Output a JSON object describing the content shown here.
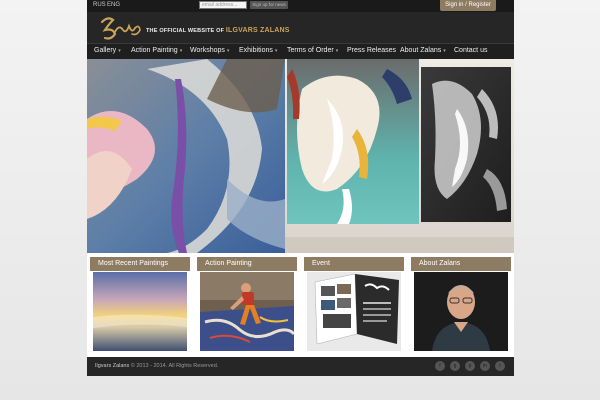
{
  "topbar": {
    "lang_rus": "RUS",
    "lang_eng": "ENG",
    "email_placeholder": "email address...",
    "signup_label": "Sign up for news",
    "signin_label": "Sign in / Register"
  },
  "header": {
    "tagline_prefix": "THE OFFICIAL WEBSITE OF",
    "tagline_name": "ILGVARS ZALANS"
  },
  "nav": {
    "items": [
      {
        "label": "Gallery",
        "has_menu": true
      },
      {
        "label": "Action Painting",
        "has_menu": true
      },
      {
        "label": "Workshops",
        "has_menu": true
      },
      {
        "label": "Exhibitions",
        "has_menu": true
      },
      {
        "label": "Terms of Order",
        "has_menu": true
      },
      {
        "label": "Press Releases",
        "has_menu": false
      },
      {
        "label": "About Zalans",
        "has_menu": true
      },
      {
        "label": "Contact us",
        "has_menu": false
      }
    ],
    "caret": "▾"
  },
  "cards": [
    {
      "title": "Most Recent Paintings"
    },
    {
      "title": "Action Painting"
    },
    {
      "title": "Event"
    },
    {
      "title": "About Zalans"
    }
  ],
  "footer": {
    "owner": "Ilgvars Zalans",
    "copyright": " © 2013 - 2014. All Rights Reserved."
  },
  "social_icons": [
    "facebook-icon",
    "google-plus-icon",
    "pinterest-icon",
    "linkedin-icon",
    "twitter-icon"
  ],
  "colors": {
    "accent": "#8d7c62",
    "header_bg": "#262626",
    "logo_gold": "#c9a45a"
  }
}
